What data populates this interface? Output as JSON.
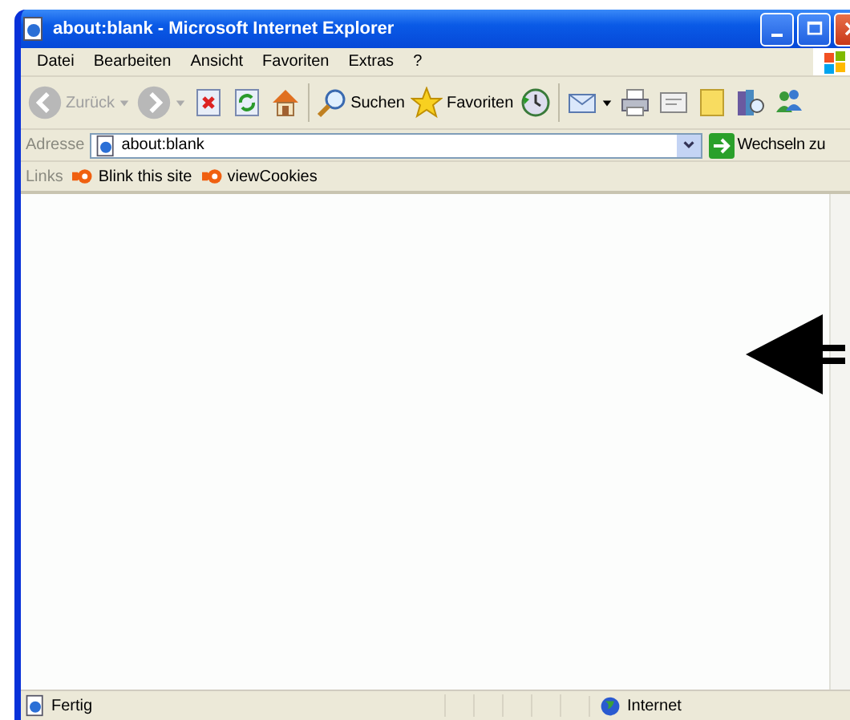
{
  "window": {
    "title": "about:blank - Microsoft Internet Explorer"
  },
  "menu": [
    "Datei",
    "Bearbeiten",
    "Ansicht",
    "Favoriten",
    "Extras",
    "?"
  ],
  "toolbar": [
    {
      "kind": "back",
      "label": "Zurück",
      "disabled": true
    },
    {
      "kind": "forward",
      "disabled": true
    },
    {
      "kind": "stop"
    },
    {
      "kind": "refresh"
    },
    {
      "kind": "home"
    },
    {
      "kind": "separator"
    },
    {
      "kind": "search",
      "label": "Suchen"
    },
    {
      "kind": "favorites",
      "label": "Favoriten"
    },
    {
      "kind": "history"
    },
    {
      "kind": "separator"
    },
    {
      "kind": "mail"
    },
    {
      "kind": "print"
    },
    {
      "kind": "edit"
    },
    {
      "kind": "note"
    },
    {
      "kind": "research"
    },
    {
      "kind": "messenger"
    }
  ],
  "address_bar": {
    "label": "Adresse",
    "value": "about:blank",
    "go_label": "Wechseln zu"
  },
  "links_bar": {
    "label": "Links",
    "items": [
      "Blink this site",
      "viewCookies"
    ]
  },
  "status_bar": {
    "text": "Fertig",
    "zone": "Internet"
  }
}
